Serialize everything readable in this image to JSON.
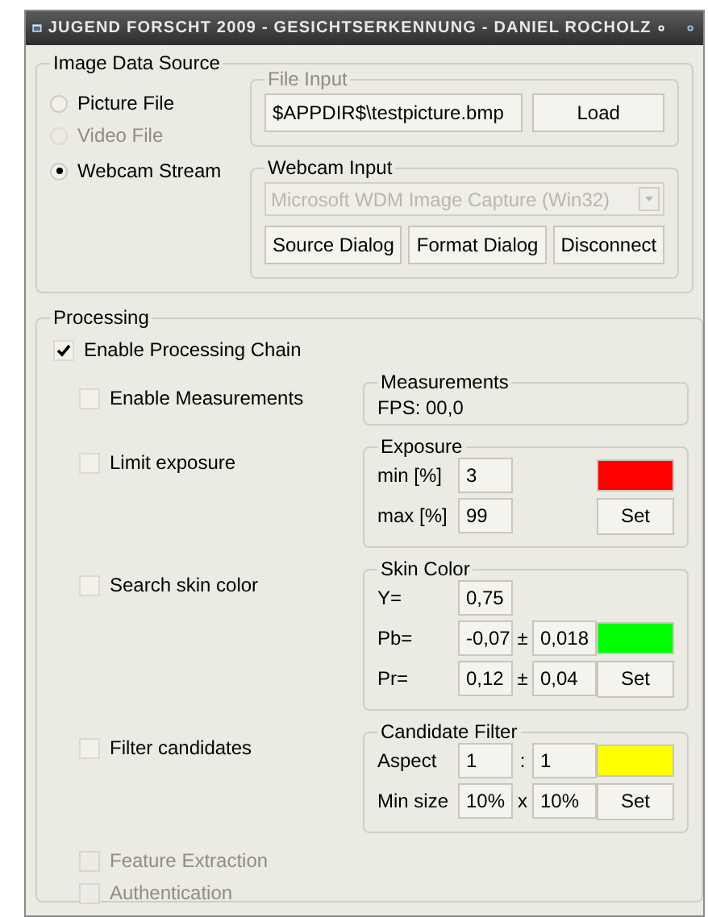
{
  "window": {
    "title": "JUGEND FORSCHT 2009 - GESICHTSERKENNUNG - DANIEL ROCHOLZ"
  },
  "source": {
    "title": "Image Data Source",
    "options": [
      {
        "label": "Picture File",
        "selected": false,
        "disabled": false
      },
      {
        "label": "Video File",
        "selected": false,
        "disabled": true
      },
      {
        "label": "Webcam Stream",
        "selected": true,
        "disabled": false
      }
    ],
    "file_input": {
      "title": "File Input",
      "disabled": true,
      "value": "$APPDIR$\\testpicture.bmp",
      "button": "Load"
    },
    "webcam_input": {
      "title": "Webcam Input",
      "device": "Microsoft WDM Image Capture (Win32)",
      "device_disabled": true,
      "buttons": [
        "Source Dialog",
        "Format Dialog",
        "Disconnect"
      ]
    }
  },
  "processing": {
    "title": "Processing",
    "chain": {
      "label": "Enable Processing Chain",
      "checked": true
    },
    "stages": [
      {
        "label": "Enable Measurements",
        "checked": false,
        "disabled": false,
        "panel": {
          "kind": "text",
          "title": "Measurements",
          "text": "FPS: 00,0"
        }
      },
      {
        "label": "Limit exposure",
        "checked": false,
        "disabled": false,
        "panel": {
          "kind": "fields",
          "title": "Exposure",
          "color": "#ff0000",
          "button": "Set",
          "rows": [
            {
              "label": "min [%]",
              "value": "3"
            },
            {
              "label": "max [%]",
              "value": "99"
            }
          ]
        }
      },
      {
        "label": "Search skin color",
        "checked": false,
        "disabled": false,
        "panel": {
          "kind": "fields",
          "title": "Skin Color",
          "color": "#00ff00",
          "button": "Set",
          "rows": [
            {
              "label": "Y=",
              "value": "0,75"
            },
            {
              "label": "Pb=",
              "value": "-0,07",
              "sep": "±",
              "value2": "0,018"
            },
            {
              "label": "Pr=",
              "value": "0,12",
              "sep": "±",
              "value2": "0,04"
            }
          ]
        }
      },
      {
        "label": "Filter candidates",
        "checked": false,
        "disabled": false,
        "panel": {
          "kind": "fields",
          "title": "Candidate Filter",
          "color": "#ffff00",
          "button": "Set",
          "rows": [
            {
              "label": "Aspect",
              "value": "1",
              "sep": ":",
              "value2": "1"
            },
            {
              "label": "Min size",
              "value": "10%",
              "sep": "x",
              "value2": "10%"
            }
          ]
        }
      }
    ],
    "extra": [
      {
        "label": "Feature Extraction",
        "checked": false,
        "disabled": true
      },
      {
        "label": "Authentication",
        "checked": false,
        "disabled": true
      }
    ]
  }
}
